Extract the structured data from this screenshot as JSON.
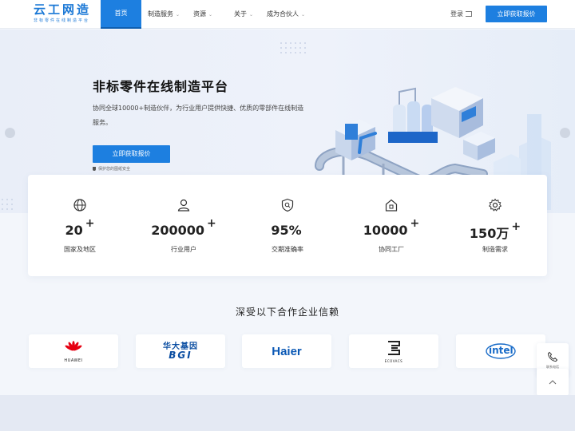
{
  "header": {
    "logo_title": "云工网造",
    "logo_subtitle": "非标零件在线制造平台",
    "nav": [
      {
        "label": "首页",
        "active": true
      },
      {
        "label": "制造服务",
        "dropdown": true
      },
      {
        "label": "资源",
        "dropdown": true
      },
      {
        "label": "关于",
        "dropdown": true
      },
      {
        "label": "成为合伙人",
        "dropdown": true
      }
    ],
    "login_label": "登录",
    "quote_button": "立即获取报价"
  },
  "hero": {
    "title": "非标零件在线制造平台",
    "description": "协同全球10000+制造伙伴，为行业用户提供快捷、优质的零部件在线制造服务。",
    "button": "立即获取报价",
    "note": "保护您的图纸安全"
  },
  "stats": [
    {
      "icon": "globe-icon",
      "value": "20",
      "plus": "+",
      "label": "国家及地区"
    },
    {
      "icon": "user-icon",
      "value": "200000",
      "plus": "+",
      "label": "行业用户"
    },
    {
      "icon": "shield-check-icon",
      "value": "95%",
      "plus": "",
      "label": "交期准确率"
    },
    {
      "icon": "factory-icon",
      "value": "10000",
      "plus": "+",
      "label": "协同工厂"
    },
    {
      "icon": "gear-icon",
      "value": "150万",
      "plus": "+",
      "label": "制造需求"
    }
  ],
  "partners": {
    "title": "深受以下合作企业信赖",
    "logos": [
      {
        "name": "huawei",
        "text": "HUAWEI"
      },
      {
        "name": "bgi",
        "text_cn": "华大基因",
        "text": "BGI"
      },
      {
        "name": "haier",
        "text": "Haier"
      },
      {
        "name": "ecovacs",
        "text": "ECOVACS"
      },
      {
        "name": "intel",
        "text": "intel"
      }
    ]
  },
  "side": {
    "phone_label": "联系电话"
  },
  "colors": {
    "brand": "#1d7fe0",
    "huawei_red": "#e60012",
    "bgi_blue": "#0b4ea2",
    "haier_blue": "#0a58b5",
    "intel_blue": "#1a6cc8"
  }
}
